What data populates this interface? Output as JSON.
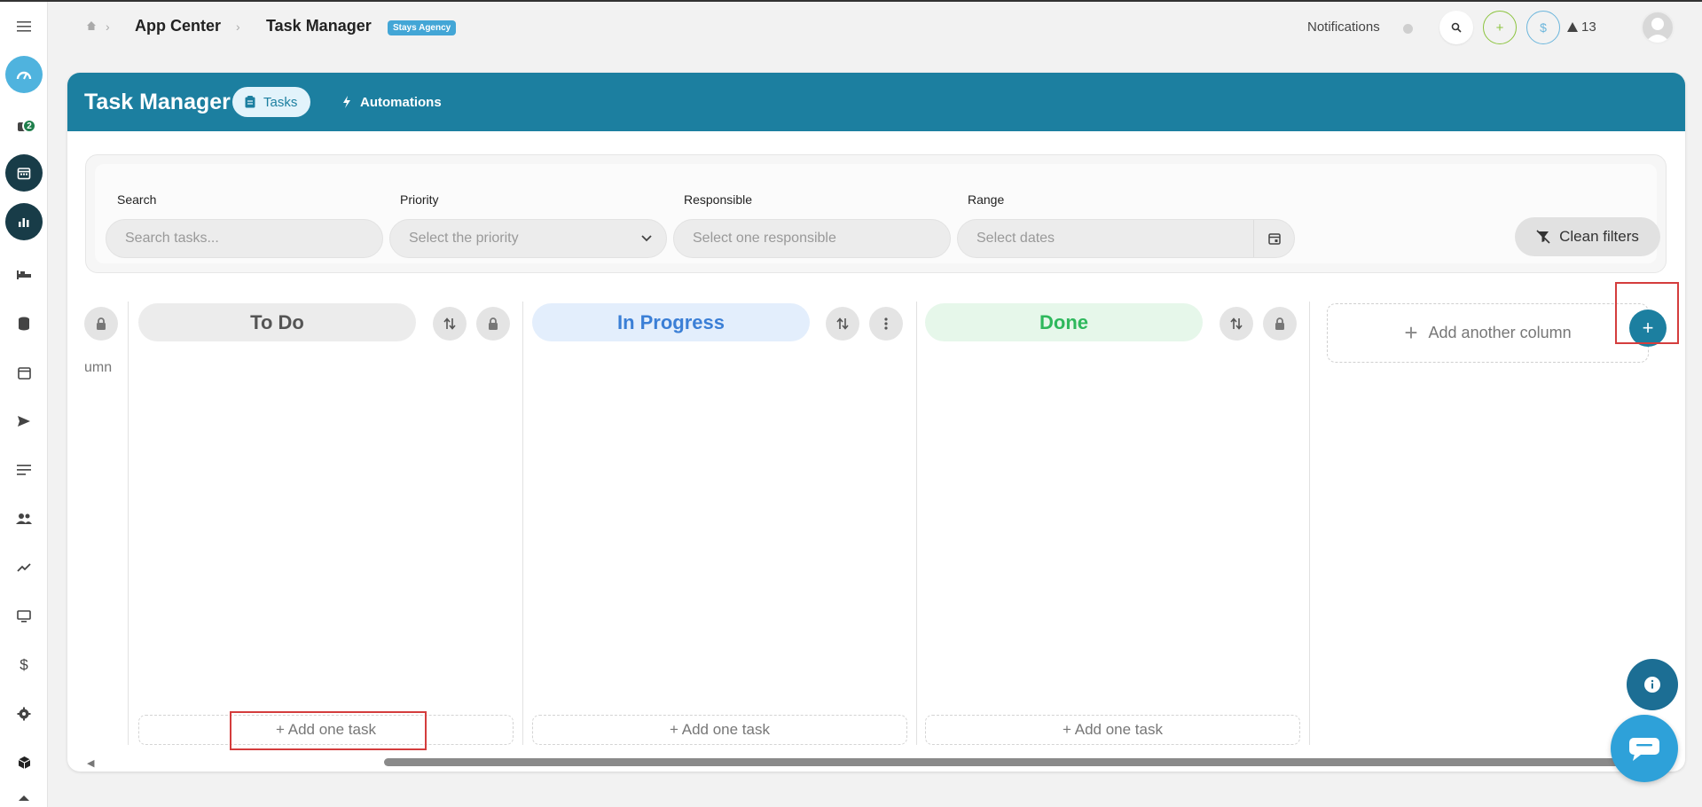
{
  "breadcrumb": {
    "app_center": "App Center",
    "task_manager": "Task Manager",
    "badge": "Stays Agency"
  },
  "header": {
    "notifications_label": "Notifications",
    "alert_count": "13",
    "sidebar_badge_count": "2"
  },
  "page": {
    "title": "Task Manager",
    "tabs": [
      {
        "label": "Tasks",
        "icon": "clipboard-icon",
        "active": true
      },
      {
        "label": "Automations",
        "icon": "bolt-icon",
        "active": false
      }
    ]
  },
  "filters": {
    "search": {
      "label": "Search",
      "placeholder": "Search tasks..."
    },
    "priority": {
      "label": "Priority",
      "placeholder": "Select the priority"
    },
    "responsible": {
      "label": "Responsible",
      "placeholder": "Select one responsible"
    },
    "range": {
      "label": "Range",
      "placeholder": "Select dates"
    },
    "clean_label": "Clean filters"
  },
  "board": {
    "partial_column_text": "umn",
    "columns": [
      {
        "title": "To Do",
        "color": "#555555",
        "bg": "#ececec",
        "add_label": "+ Add one task"
      },
      {
        "title": "In Progress",
        "color": "#3b7fd6",
        "bg": "#e3eefc",
        "add_label": "+ Add one task"
      },
      {
        "title": "Done",
        "color": "#2eb85c",
        "bg": "#e6f7ea",
        "add_label": "+ Add one task"
      }
    ],
    "add_column_label": "Add another column"
  },
  "colors": {
    "brand": "#1c7fa0",
    "highlight": "#d43d3d"
  }
}
